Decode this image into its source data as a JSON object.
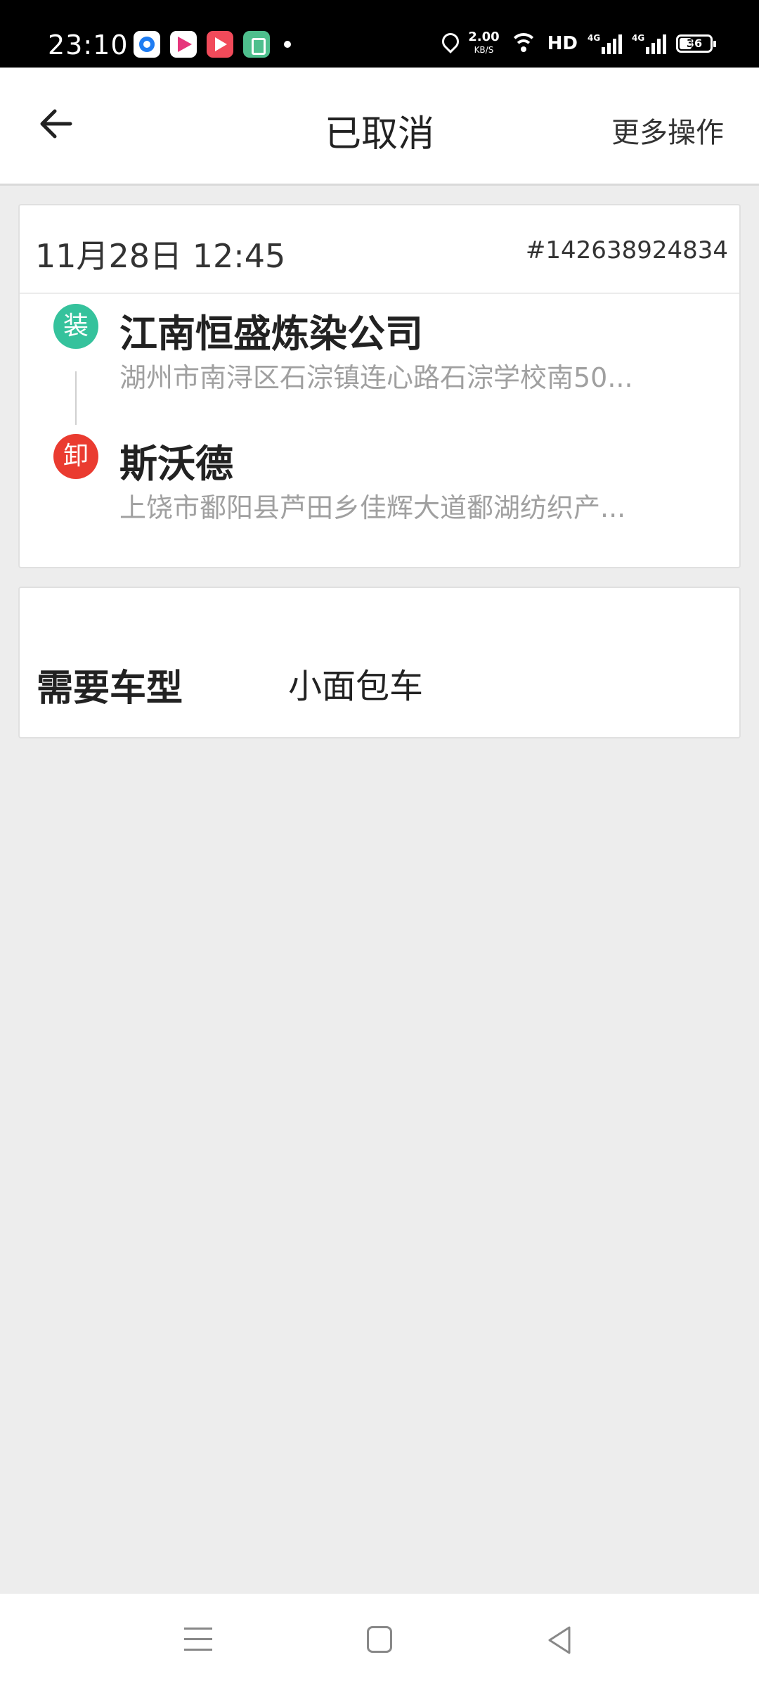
{
  "status_bar": {
    "time": "23:10",
    "app_icons": [
      "app-icon-blue",
      "app-icon-play",
      "app-icon-red-play",
      "app-icon-green"
    ],
    "speed_value": "2.00",
    "speed_unit": "KB/S",
    "hd_label": "HD",
    "signal1_label": "4G",
    "signal2_label": "4G",
    "battery": "36"
  },
  "header": {
    "back_icon": "arrow-left-icon",
    "title": "已取消",
    "more_label": "更多操作"
  },
  "order": {
    "datetime": "11月28日 12:45",
    "order_number": "#142638924834",
    "load": {
      "badge": "装",
      "name": "江南恒盛炼染公司",
      "address": "湖州市南浔区石淙镇连心路石淙学校南50..."
    },
    "unload": {
      "badge": "卸",
      "name": "斯沃德",
      "address": "上饶市鄱阳县芦田乡佳辉大道鄱湖纺织产..."
    }
  },
  "vehicle": {
    "label": "需要车型",
    "value": "小面包车"
  },
  "colors": {
    "load_badge": "#35c29c",
    "unload_badge": "#ea3b30",
    "background": "#ededed"
  },
  "nav": {
    "menu_icon": "menu-icon",
    "home_icon": "home-icon",
    "back_icon": "back-triangle-icon"
  }
}
